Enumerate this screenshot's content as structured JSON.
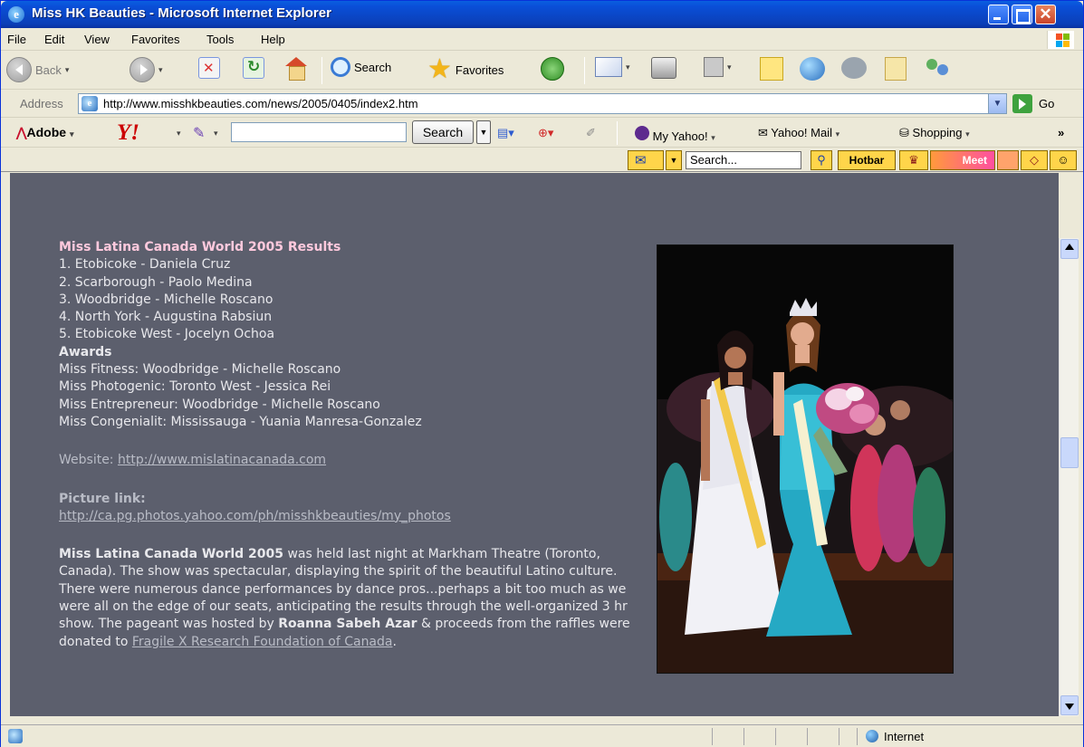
{
  "window": {
    "title": "Miss HK Beauties - Microsoft Internet Explorer"
  },
  "menu": [
    "File",
    "Edit",
    "View",
    "Favorites",
    "Tools",
    "Help"
  ],
  "toolbar": {
    "back": "Back",
    "search": "Search",
    "favorites": "Favorites"
  },
  "address": {
    "label": "Address",
    "url": "http://www.misshkbeauties.com/news/2005/0405/index2.htm",
    "go": "Go"
  },
  "yahoo_toolbar": {
    "adobe": "Adobe",
    "search_button": "Search",
    "my_yahoo": "My Yahoo!",
    "yahoo_mail": "Yahoo! Mail",
    "shopping": "Shopping",
    "more": "»"
  },
  "hotbar": {
    "search_placeholder": "Search...",
    "hotbar_label": "Hotbar",
    "meet_label": "Meet"
  },
  "content": {
    "results_heading": "Miss Latina Canada World 2005 Results",
    "results": [
      "1. Etobicoke - Daniela Cruz",
      "2. Scarborough - Paolo Medina",
      "3. Woodbridge - Michelle Roscano",
      "4. North York - Augustina Rabsiun",
      "5. Etobicoke West - Jocelyn Ochoa"
    ],
    "awards_heading": "Awards",
    "awards": [
      "Miss Fitness: Woodbridge - Michelle Roscano",
      "Miss Photogenic: Toronto West - Jessica Rei",
      "Miss Entrepreneur: Woodbridge - Michelle Roscano",
      "Miss Congenialit: Mississauga - Yuania Manresa-Gonzalez"
    ],
    "website_label": "Website: ",
    "website_url": "http://www.mislatinacanada.com",
    "picture_link_label": "Picture link:",
    "picture_link_url": "http://ca.pg.photos.yahoo.com/ph/misshkbeauties/my_photos",
    "article": {
      "event_name": "Miss Latina Canada World 2005",
      "text1": " was held last night at Markham Theatre (Toronto, Canada). The show was spectacular, displaying the spirit of the beautiful Latino culture. There were numerous dance performances by dance pros...perhaps a bit too much as we were all on the edge of our seats, anticipating the results through the well-organized 3 hr show. The pageant was hosted by ",
      "host": "Roanna Sabeh Azar",
      "text2": " & proceeds from the raffles were donated to ",
      "foundation_link": "Fragile X Research Foundation of Canada",
      "text3": "."
    }
  },
  "status": {
    "zone": "Internet"
  },
  "colors": {
    "page_bg": "#5c5f6d",
    "heading_pink": "#ffc9dd",
    "title_bar": "#0a4fd8"
  }
}
